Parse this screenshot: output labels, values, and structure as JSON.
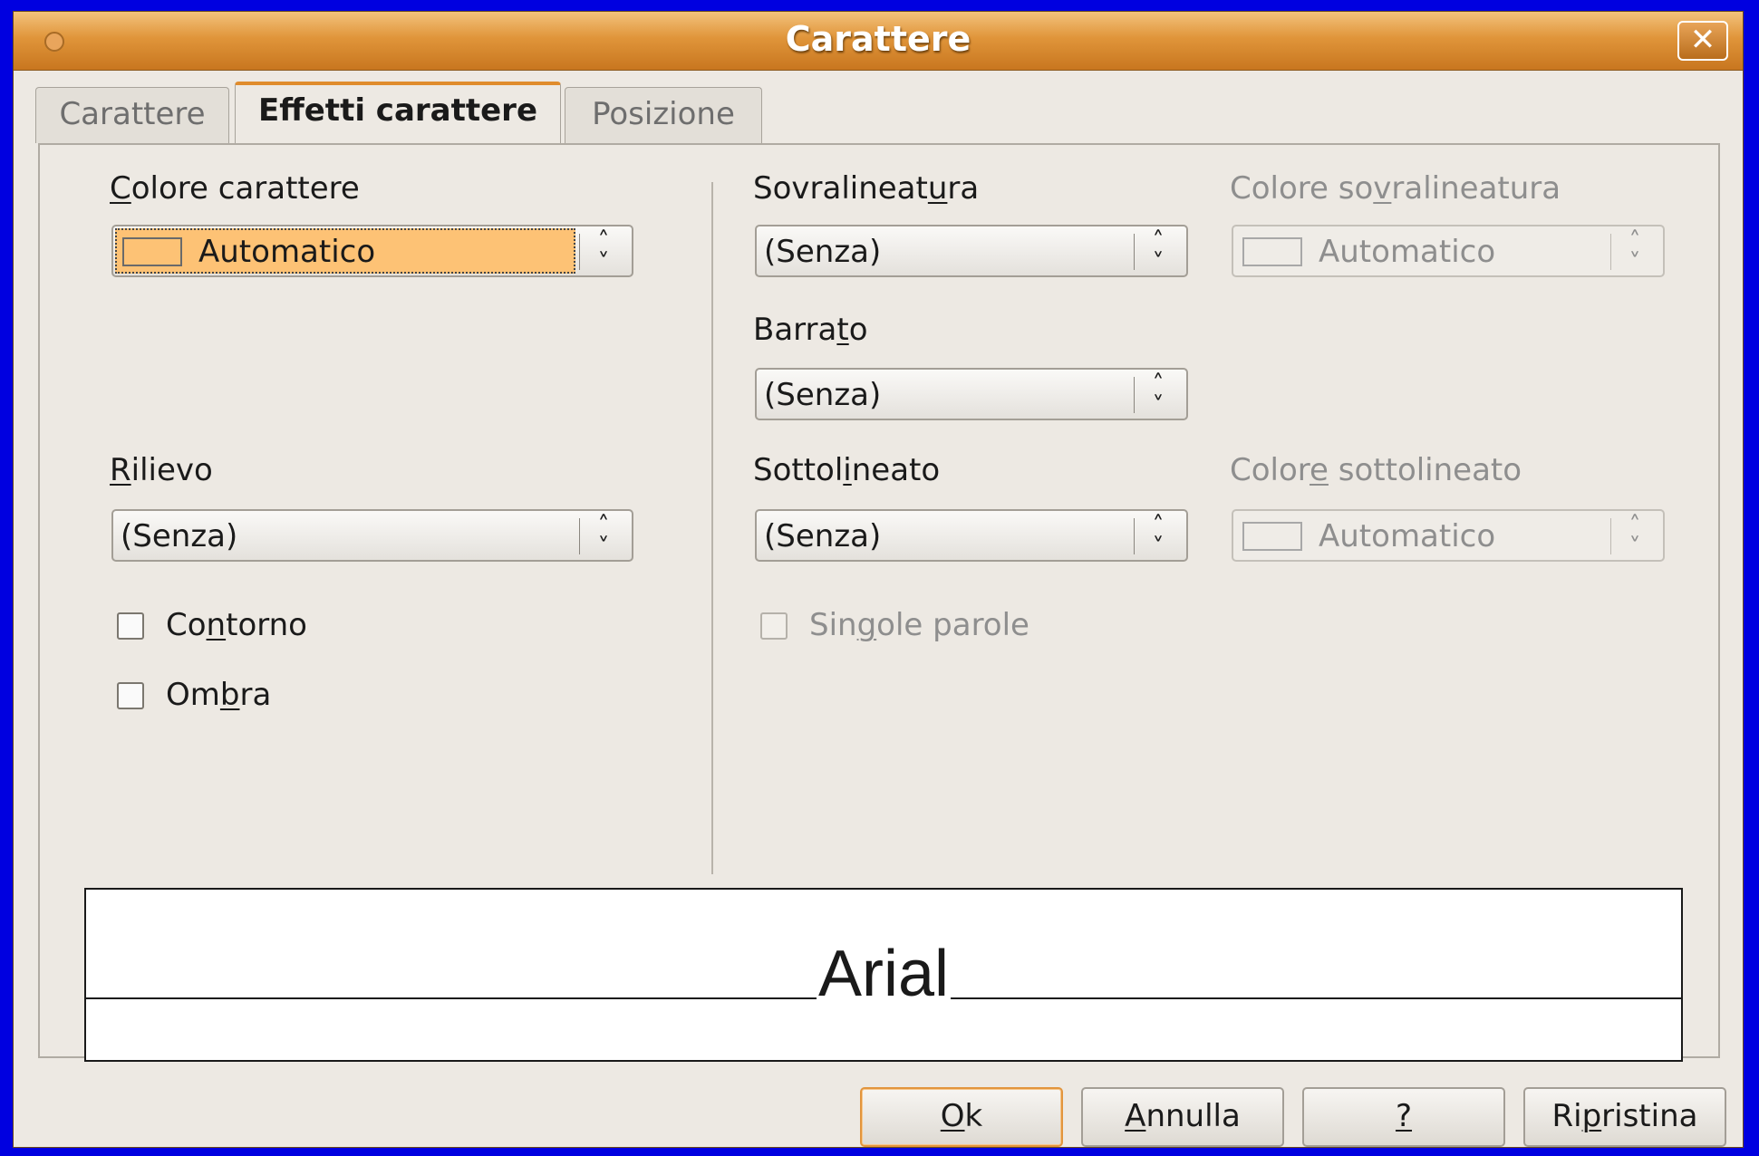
{
  "window": {
    "title": "Carattere",
    "close_label": "✕"
  },
  "tabs": [
    {
      "label": "Carattere",
      "active": false
    },
    {
      "label": "Effetti carattere",
      "active": true
    },
    {
      "label": "Posizione",
      "active": false
    }
  ],
  "font_color": {
    "label_pre": "",
    "label_u": "C",
    "label_post": "olore carattere",
    "value": "Automatico"
  },
  "relief": {
    "label_pre": "",
    "label_u": "R",
    "label_post": "ilievo",
    "value": "(Senza)"
  },
  "outline": {
    "label_pre": "Co",
    "label_u": "n",
    "label_post": "torno",
    "checked": false
  },
  "shadow": {
    "label_pre": "Om",
    "label_u": "b",
    "label_post": "ra",
    "checked": false
  },
  "overline": {
    "label_pre": "Sovralineat",
    "label_u": "u",
    "label_post": "ra",
    "value": "(Senza)"
  },
  "overline_color": {
    "label_pre": "Colore so",
    "label_u": "v",
    "label_post": "ralineatura",
    "value": "Automatico"
  },
  "strikethrough": {
    "label_pre": "Barra",
    "label_u": "t",
    "label_post": "o",
    "value": "(Senza)"
  },
  "underline": {
    "label_pre": "Sottol",
    "label_u": "i",
    "label_post": "neato",
    "value": "(Senza)"
  },
  "underline_color": {
    "label_pre": "Color",
    "label_u": "e",
    "label_post": " sottolineato",
    "value": "Automatico"
  },
  "individual_words": {
    "label_pre": "Sin",
    "label_u": "g",
    "label_post": "ole parole",
    "checked": false
  },
  "preview": {
    "text": "Arial"
  },
  "buttons": {
    "ok": {
      "pre": "",
      "u": "O",
      "post": "k"
    },
    "cancel": {
      "pre": "",
      "u": "A",
      "post": "nnulla"
    },
    "help": {
      "pre": "",
      "u": "?",
      "post": ""
    },
    "reset": {
      "pre": "Ri",
      "u": "p",
      "post": "ristina"
    }
  },
  "colors": {
    "accent": "#e0953a",
    "highlight": "#fdc275",
    "frame": "#0000e0"
  },
  "icons": {
    "close": "close-icon",
    "spin": "up-down-chevron-icon",
    "window_menu": "circle-icon"
  }
}
